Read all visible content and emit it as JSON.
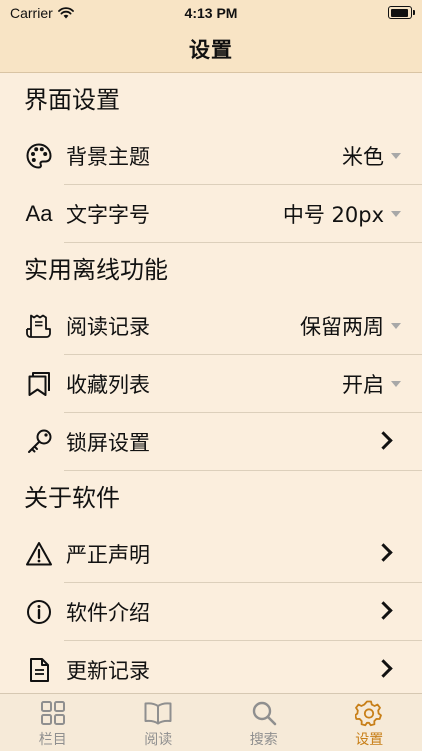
{
  "status": {
    "carrier": "Carrier",
    "time": "4:13 PM"
  },
  "nav": {
    "title": "设置"
  },
  "sections": [
    {
      "title": "界面设置"
    },
    {
      "title": "实用离线功能"
    },
    {
      "title": "关于软件"
    }
  ],
  "rows": {
    "theme": {
      "label": "背景主题",
      "value": "米色",
      "icon": "palette-icon"
    },
    "font": {
      "label": "文字字号",
      "value": "中号 20px",
      "icon": "text-size-icon",
      "icon_text": "Aa"
    },
    "history": {
      "label": "阅读记录",
      "value": "保留两周",
      "icon": "receipt-icon"
    },
    "bookmarks": {
      "label": "收藏列表",
      "value": "开启",
      "icon": "bookmarks-icon"
    },
    "lock": {
      "label": "锁屏设置",
      "icon": "key-icon"
    },
    "disclaimer": {
      "label": "严正声明",
      "icon": "warning-icon"
    },
    "intro": {
      "label": "软件介绍",
      "icon": "info-icon"
    },
    "changelog": {
      "label": "更新记录",
      "icon": "document-icon"
    }
  },
  "tabs": [
    {
      "label": "栏目",
      "icon": "grid-icon",
      "active": false
    },
    {
      "label": "阅读",
      "icon": "book-icon",
      "active": false
    },
    {
      "label": "搜索",
      "icon": "search-icon",
      "active": false
    },
    {
      "label": "设置",
      "icon": "gear-icon",
      "active": true
    }
  ],
  "colors": {
    "background": "#fbeedd",
    "bar": "#f8e4c5",
    "accent": "#c87f18",
    "inactive": "#8f8f8f"
  }
}
